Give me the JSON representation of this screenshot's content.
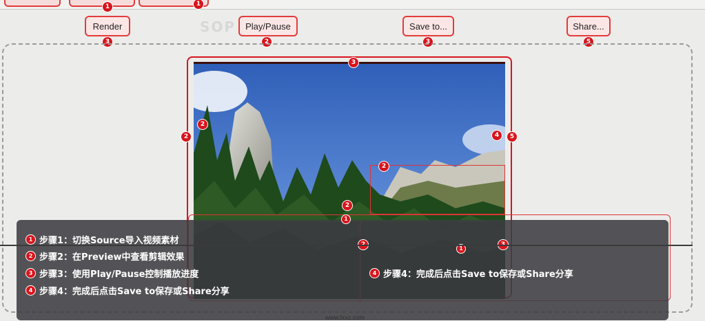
{
  "toolbar": {
    "render_label": "Render",
    "render_badge": "3",
    "play_pause_label": "Play/Pause",
    "play_pause_badge": "2",
    "save_label": "Save to...",
    "save_badge": "3",
    "share_label": "Share...",
    "share_badge": "5",
    "logo_text": "SOP"
  },
  "top_buttons": {
    "badge_a": "1",
    "badge_b": "1"
  },
  "preview": {
    "badges": {
      "top": "3",
      "left_outer": "2",
      "left_inner": "2",
      "right_inner": "4",
      "right_outer": "5",
      "inset": "2",
      "center": "2",
      "bottom_center": "1",
      "panel_left": "2",
      "panel_mid": "1",
      "panel_right": "3"
    }
  },
  "steps": [
    {
      "num": "1",
      "text": "步骤1：切换Source导入视频素材"
    },
    {
      "num": "2",
      "text": "步骤2：在Preview中查看剪辑效果"
    },
    {
      "num": "3",
      "text": "步骤3：使用Play/Pause控制播放进度"
    },
    {
      "num": "4",
      "text": "步骤4：完成后点击Save to保存或Share分享"
    }
  ],
  "step_right": {
    "num": "4",
    "text": "步骤4：完成后点击Save to保存或Share分享"
  },
  "footer": {
    "url": "www.fxxz.com"
  },
  "colors": {
    "accent": "#d8141c",
    "highlight_fill": "#fbe6e6",
    "panel": "#3e3e42"
  }
}
